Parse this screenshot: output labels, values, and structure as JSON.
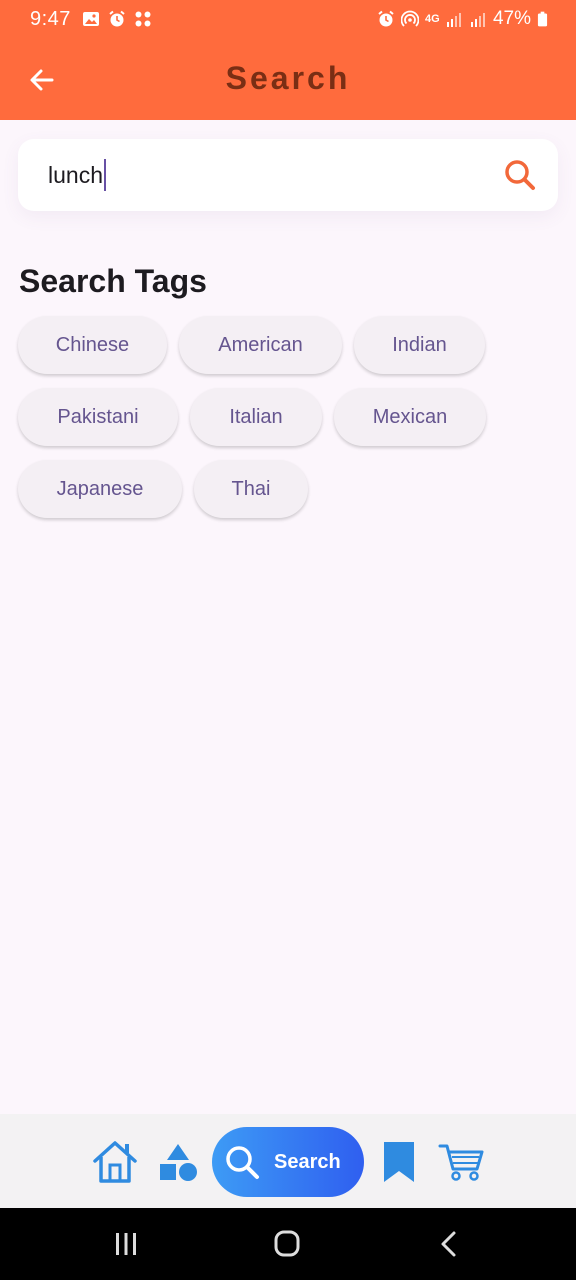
{
  "status_bar": {
    "time": "9:47",
    "battery": "47%",
    "network": "4G"
  },
  "app_bar": {
    "title": "Search"
  },
  "search": {
    "value": "lunch"
  },
  "tags_section": {
    "title": "Search Tags",
    "tags": [
      "Chinese",
      "American",
      "Indian",
      "Pakistani",
      "Italian",
      "Mexican",
      "Japanese",
      "Thai"
    ]
  },
  "bottom_nav": {
    "items": [
      {
        "icon": "home-icon"
      },
      {
        "icon": "categories-icon"
      },
      {
        "icon": "search-icon",
        "label": "Search",
        "active": true
      },
      {
        "icon": "bookmark-icon"
      },
      {
        "icon": "cart-icon"
      }
    ]
  },
  "colors": {
    "app_bar": "#ff6b3d",
    "title": "#7a2e14",
    "chip_text": "#65558f",
    "nav_icon": "#2f8be0",
    "nav_active_start": "#3d9bf5",
    "nav_active_end": "#2f5ff0"
  }
}
